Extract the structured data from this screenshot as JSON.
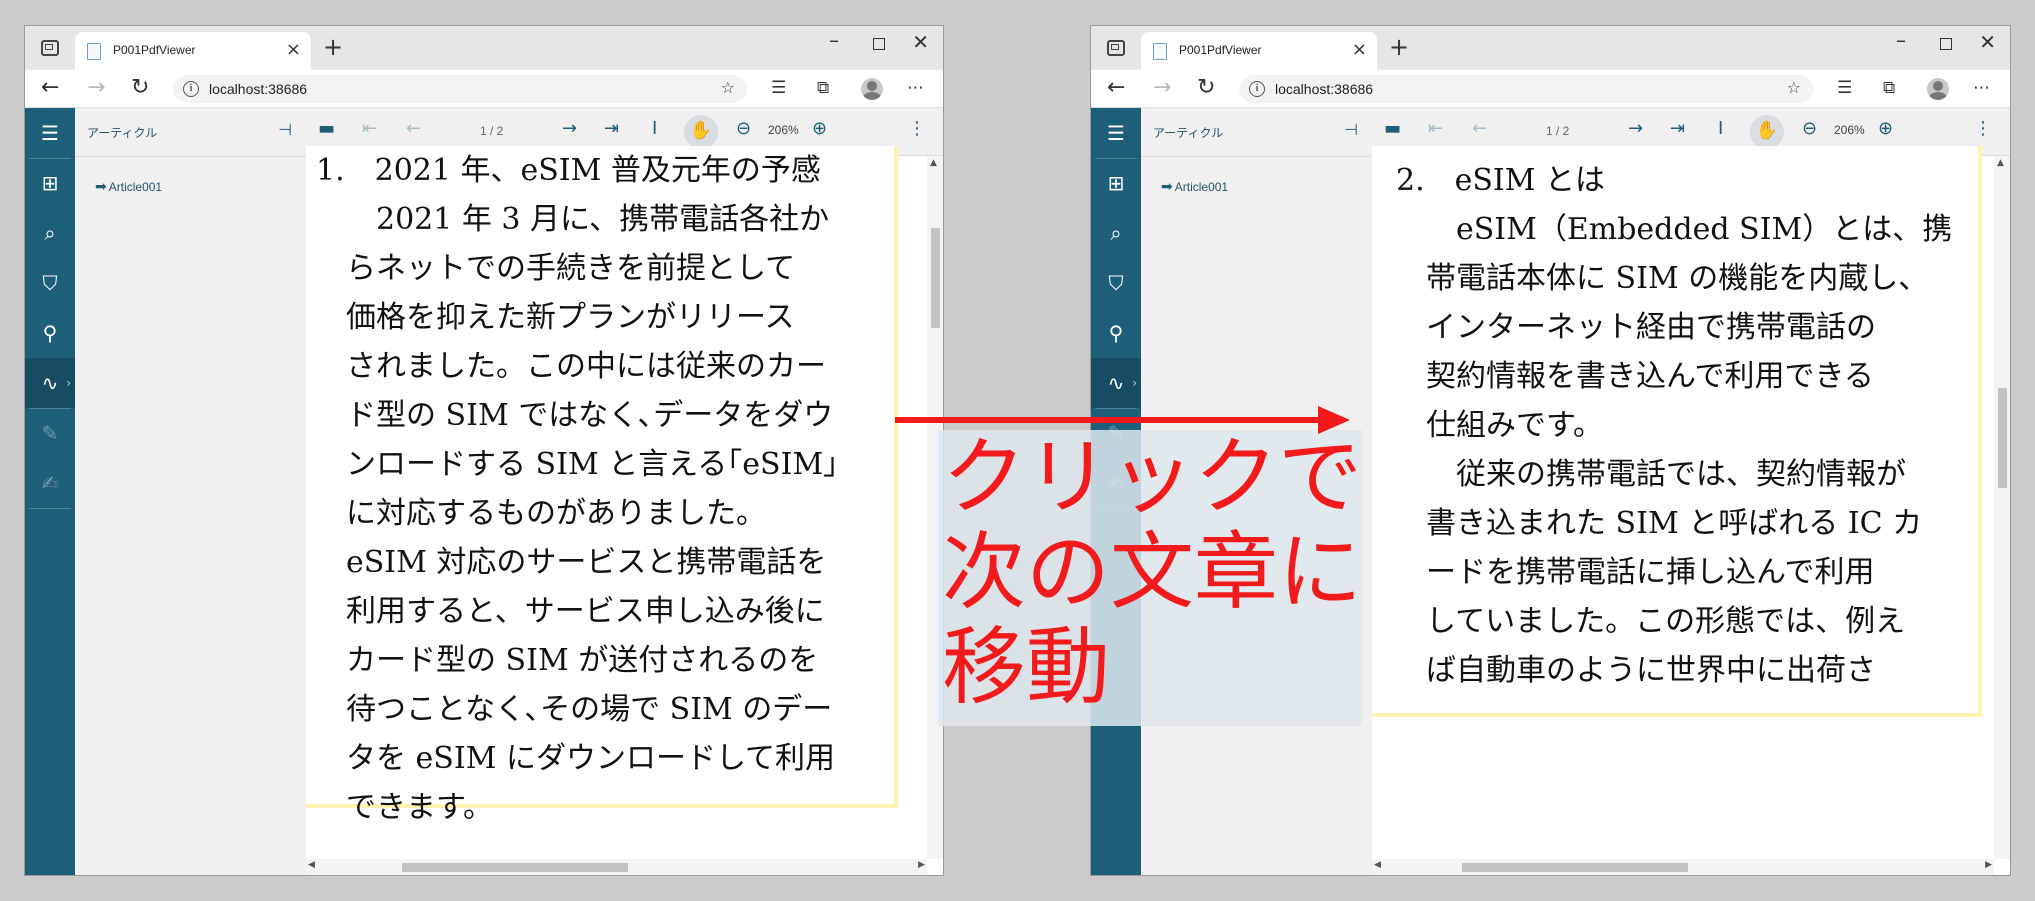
{
  "browser": {
    "tab_title": "P001PdfViewer",
    "url": "localhost:38686",
    "close_glyph": "×",
    "newtab_glyph": "+"
  },
  "viewer": {
    "panel_title": "アーティクル",
    "article_item": "Article001",
    "page_indicator": "1 / 2",
    "zoom": "206%"
  },
  "left_page": {
    "lines": [
      "1.　2021 年、eSIM 普及元年の予感",
      "　2021 年 3 月に、携帯電話各社か",
      "らネットでの手続きを前提として",
      "価格を抑えた新プランがリリース",
      "されました。この中には従来のカー",
      "ド型の SIM ではなく､データをダウ",
      "ンロードする SIM と言える｢eSIM｣",
      "に対応するものがありました。",
      "eSIM 対応のサービスと携帯電話を",
      "利用すると、サービス申し込み後に",
      "カード型の SIM が送付されるのを",
      "待つことなく､その場で SIM のデー",
      "タを eSIM にダウンロードして利用",
      "できます。"
    ]
  },
  "right_page": {
    "lines": [
      "2.　eSIM とは",
      "　eSIM（Embedded SIM）とは、携",
      "帯電話本体に SIM の機能を内蔵し、",
      "インターネット経由で携帯電話の",
      "契約情報を書き込んで利用できる",
      "仕組みです。",
      "　従来の携帯電話では、契約情報が",
      "書き込まれた SIM と呼ばれる IC カ",
      "ードを携帯電話に挿し込んで利用",
      "していました。この形態では、例え",
      "ば自動車のように世界中に出荷さ"
    ]
  },
  "annotation": {
    "line1": "クリックで",
    "line2": "次の文章に",
    "line3": "移動",
    "color": "#f21a1a"
  },
  "colors": {
    "rail": "#1d5e79",
    "page_border": "#fff3b0"
  }
}
